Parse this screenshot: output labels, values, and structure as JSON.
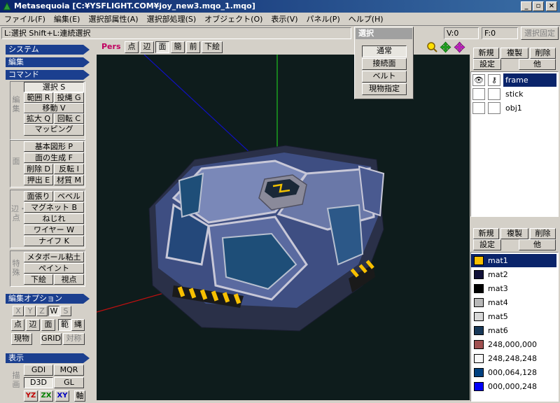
{
  "window": {
    "title": "Metasequoia [C:¥YSFLIGHT.COM¥joy_new3.mqo_1.mqo]"
  },
  "menu": [
    "ファイル(F)",
    "編集(E)",
    "選択部属性(A)",
    "選択部処理(S)",
    "オブジェクト(O)",
    "表示(V)",
    "パネル(P)",
    "ヘルプ(H)"
  ],
  "status": {
    "hint": "L:選択  Shift+L:連続選択",
    "v_count": "V:0",
    "f_count": "F:0",
    "lock_button": "選択固定"
  },
  "select_popup": {
    "title": "選択",
    "buttons": [
      "通常",
      "接続面",
      "ベルト",
      "現物指定"
    ]
  },
  "left_panel": {
    "system": "システム",
    "edit": "編集",
    "command": "コマンド",
    "group_labels": {
      "g1": "編集",
      "g2": "面",
      "g3": "辺・点",
      "g4": "特殊"
    },
    "cmd": {
      "select": "選択 S",
      "range": "範囲 R",
      "lasso": "投縄 G",
      "move": "移動 V",
      "scale": "拡大 Q",
      "rotate": "回転 C",
      "mapping": "マッピング",
      "primitive": "基本図形 P",
      "face_gen": "面の生成 F",
      "delete": "削除 D",
      "flip": "反転 I",
      "extrude": "押出 E",
      "material": "材質 M",
      "stretch": "面張り",
      "bevel": "ベベル",
      "magnet": "マグネット B",
      "twist": "ねじれ",
      "wire": "ワイヤー W",
      "knife": "ナイフ K",
      "metaball": "メタボール粘土",
      "paint": "ペイント",
      "underlay": "下絵",
      "viewpoint": "視点"
    },
    "edit_options": {
      "header": "編集オプション",
      "axes": [
        "X",
        "Y",
        "Z",
        "W",
        "S"
      ],
      "modes": [
        "点",
        "辺",
        "面",
        "範",
        "縄"
      ],
      "real": "現物",
      "grid": "GRID",
      "symmetry": "対称"
    },
    "display": {
      "header": "表示",
      "side_label": "描画",
      "gdi": "GDI",
      "mqr": "MQR",
      "d3d": "D3D",
      "gl": "GL",
      "planes": [
        "YZ",
        "ZX",
        "XY"
      ],
      "axis": "軸"
    }
  },
  "viewbar": {
    "pers": "Pers",
    "buttons": [
      "点",
      "辺",
      "面",
      "簡",
      "前",
      "下絵"
    ]
  },
  "object_panel": {
    "buttons": [
      "新規",
      "複製",
      "削除",
      "設定",
      "他"
    ],
    "objects": [
      {
        "name": "frame",
        "selected": true,
        "visible": true,
        "locked": false
      },
      {
        "name": "stick",
        "selected": false,
        "visible": false,
        "locked": false
      },
      {
        "name": "obj1",
        "selected": false,
        "visible": false,
        "locked": false
      }
    ]
  },
  "material_panel": {
    "buttons": [
      "新規",
      "複製",
      "削除",
      "設定",
      "他"
    ],
    "materials": [
      {
        "name": "mat1",
        "color": "#f8c000",
        "selected": true
      },
      {
        "name": "mat2",
        "color": "#101038",
        "selected": false
      },
      {
        "name": "mat3",
        "color": "#000000",
        "selected": false
      },
      {
        "name": "mat4",
        "color": "#b8b8b8",
        "selected": false
      },
      {
        "name": "mat5",
        "color": "#d8d8d8",
        "selected": false
      },
      {
        "name": "mat6",
        "color": "#183858",
        "selected": false
      },
      {
        "name": "248,000,000",
        "color": "#a05050",
        "selected": false
      },
      {
        "name": "248,248,248",
        "color": "#f8f8f8",
        "selected": false
      },
      {
        "name": "000,064,128",
        "color": "#004080",
        "selected": false
      },
      {
        "name": "000,000,248",
        "color": "#0000f8",
        "selected": false
      }
    ]
  },
  "colors": {
    "title_bar": "#0a246a",
    "panel_header": "#1b3f8f",
    "viewport_bg": "#0e1c1c",
    "selection": "#0a246a"
  }
}
